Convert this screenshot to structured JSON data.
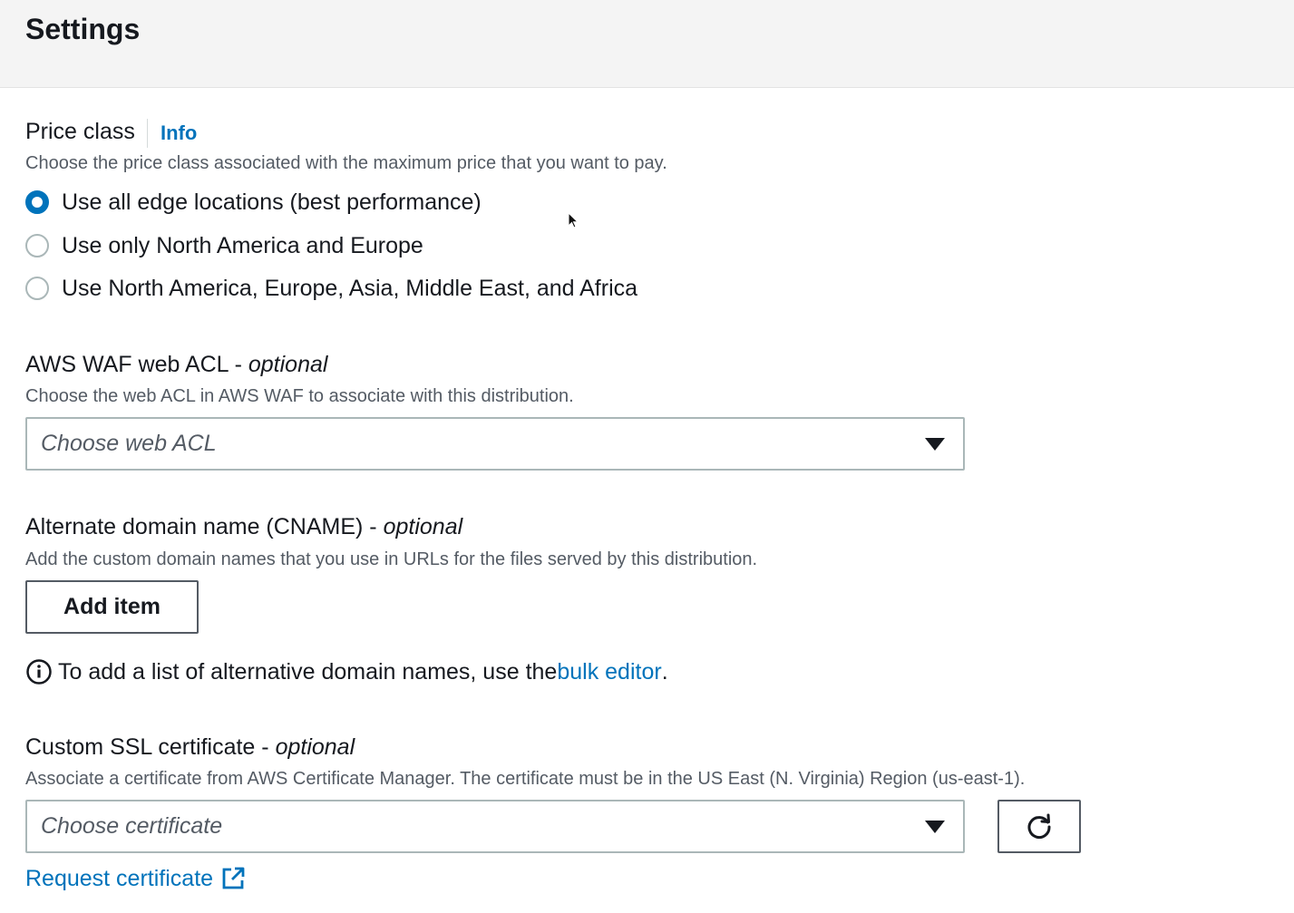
{
  "header": {
    "title": "Settings"
  },
  "price_class": {
    "label": "Price class",
    "info": "Info",
    "description": "Choose the price class associated with the maximum price that you want to pay.",
    "options": [
      {
        "label": "Use all edge locations (best performance)",
        "selected": true
      },
      {
        "label": "Use only North America and Europe",
        "selected": false
      },
      {
        "label": "Use North America, Europe, Asia, Middle East, and Africa",
        "selected": false
      }
    ]
  },
  "waf": {
    "label": "AWS WAF web ACL - ",
    "optional": "optional",
    "description": "Choose the web ACL in AWS WAF to associate with this distribution.",
    "placeholder": "Choose web ACL"
  },
  "cname": {
    "label": "Alternate domain name (CNAME) - ",
    "optional": "optional",
    "description": "Add the custom domain names that you use in URLs for the files served by this distribution.",
    "add_button": "Add item",
    "note_prefix": "To add a list of alternative domain names, use the ",
    "note_link": "bulk editor",
    "note_suffix": "."
  },
  "ssl": {
    "label": "Custom SSL certificate - ",
    "optional": "optional",
    "description": "Associate a certificate from AWS Certificate Manager. The certificate must be in the US East (N. Virginia) Region (us-east-1).",
    "placeholder": "Choose certificate",
    "request_link": "Request certificate"
  },
  "icons": {
    "info": "info-circle-icon",
    "caret": "caret-down-icon",
    "refresh": "refresh-icon",
    "external": "external-link-icon"
  },
  "colors": {
    "link": "#0073bb",
    "text": "#16191f",
    "secondary_text": "#545b64",
    "header_bg": "#f4f4f4"
  }
}
